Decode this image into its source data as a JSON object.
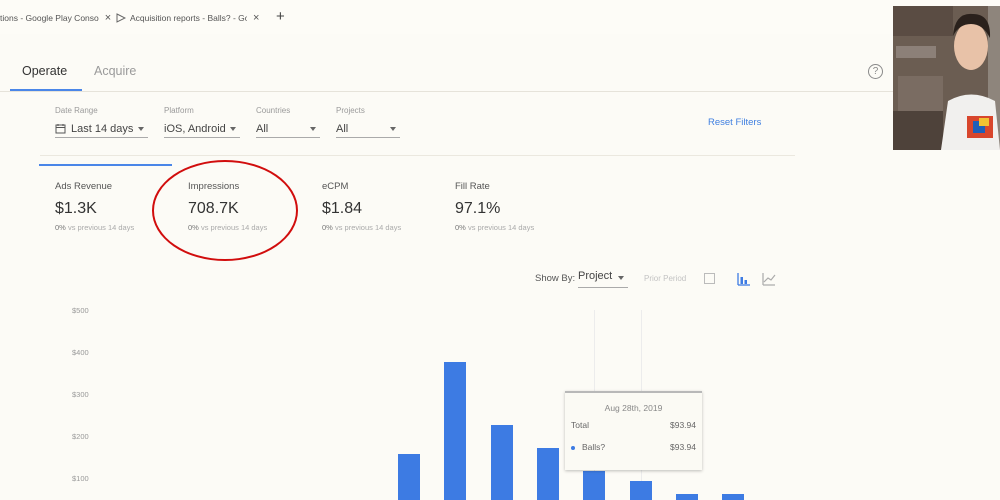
{
  "browser": {
    "tabs": [
      {
        "title": "tions - Google Play Conso"
      },
      {
        "title": "Acquisition reports - Balls? - Google"
      }
    ],
    "new_tab": "+"
  },
  "nav": {
    "tabs": [
      {
        "label": "Operate",
        "active": true
      },
      {
        "label": "Acquire",
        "active": false
      }
    ],
    "help": "?"
  },
  "filters": {
    "date_range": {
      "label": "Date Range",
      "value": "Last 14 days"
    },
    "platform": {
      "label": "Platform",
      "value": "iOS, Android"
    },
    "countries": {
      "label": "Countries",
      "value": "All"
    },
    "projects": {
      "label": "Projects",
      "value": "All"
    },
    "reset": "Reset Filters"
  },
  "metrics": [
    {
      "label": "Ads Revenue",
      "value": "$1.3K",
      "pct": "0%",
      "comparison": "vs previous 14 days"
    },
    {
      "label": "Impressions",
      "value": "708.7K",
      "pct": "0%",
      "comparison": "vs previous 14 days"
    },
    {
      "label": "eCPM",
      "value": "$1.84",
      "pct": "0%",
      "comparison": "vs previous 14 days"
    },
    {
      "label": "Fill Rate",
      "value": "97.1%",
      "pct": "0%",
      "comparison": "vs previous 14 days"
    }
  ],
  "chart_controls": {
    "show_by_label": "Show By:",
    "show_by_value": "Project",
    "prior_period": "Prior Period"
  },
  "chart_data": {
    "type": "bar",
    "ylim": [
      0,
      500
    ],
    "ytick_labels": [
      "$500",
      "$400",
      "$300",
      "$200",
      "$100"
    ],
    "bar_color": "#3d7be3",
    "values": [
      155,
      375,
      225,
      170,
      115,
      90,
      60,
      60
    ],
    "tooltip": {
      "date": "Aug 28th, 2019",
      "rows": [
        {
          "label": "Total",
          "value": "$93.94"
        },
        {
          "label": "Balls?",
          "value": "$93.94"
        }
      ]
    }
  },
  "annotation": {
    "color": "#d10d0d",
    "target": "Impressions"
  }
}
